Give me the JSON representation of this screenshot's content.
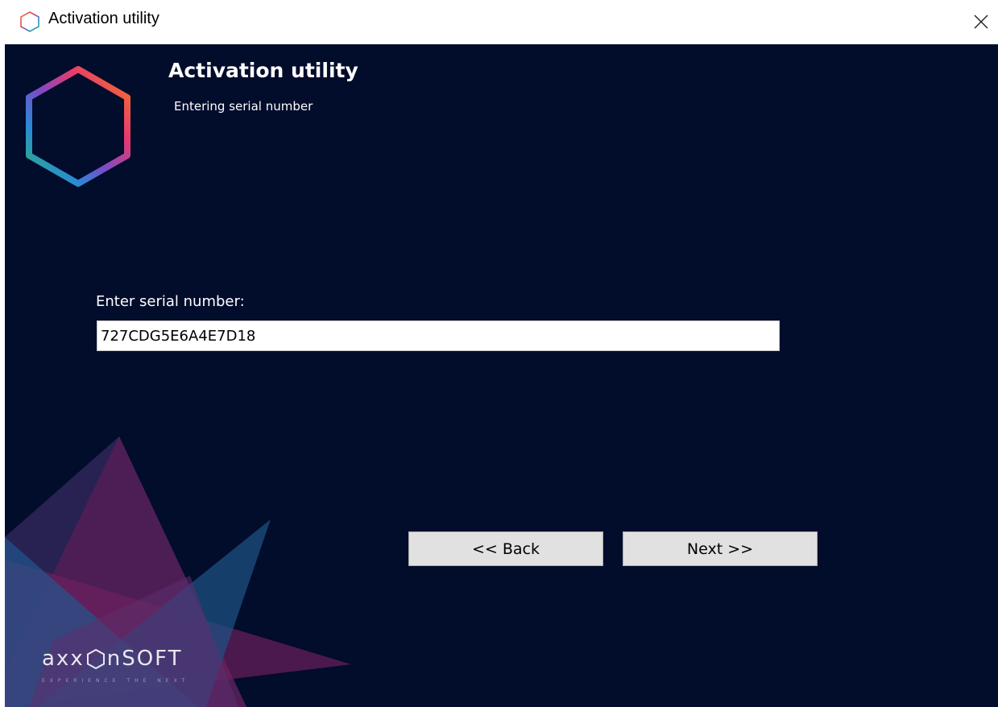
{
  "window": {
    "title": "Activation utility",
    "icon": "hexagon-outline-icon",
    "close_icon": "close-icon"
  },
  "header": {
    "title": "Activation utility",
    "subtitle": "Entering serial number",
    "logo": "gradient-hexagon-logo"
  },
  "form": {
    "label": "Enter serial number:",
    "serial_value": "727CDG5E6A4E7D18"
  },
  "buttons": {
    "back_label": "<< Back",
    "next_label": "Next >>"
  },
  "brand": {
    "name": "axxonsoft",
    "name_left": "axx",
    "name_right": "nSOFT",
    "tagline": "EXPERIENCE THE NEXT"
  },
  "colors": {
    "background": "#020c2b",
    "hex_orange": "#f47b20",
    "hex_pink": "#e63a6e",
    "hex_purple": "#7a4bc9",
    "hex_blue": "#2a8ad6",
    "hex_green": "#2bb673",
    "decor_magenta": "#6b1f5e",
    "decor_blue": "#1e4f82"
  }
}
